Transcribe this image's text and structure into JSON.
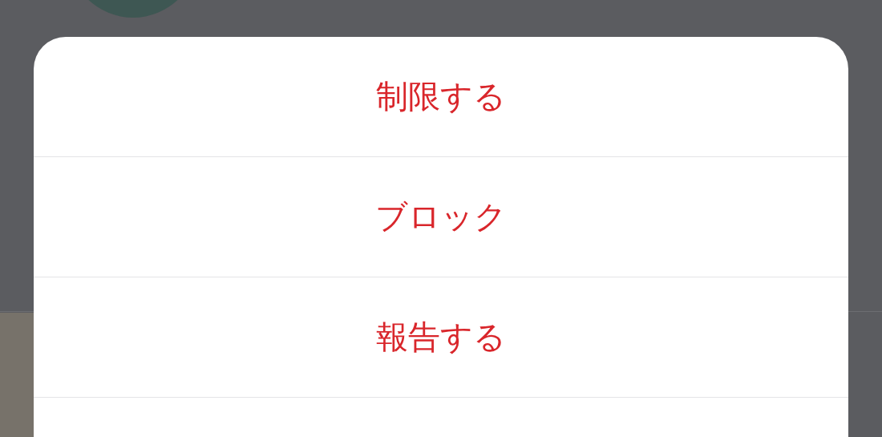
{
  "action_sheet": {
    "items": [
      {
        "label": "制限する"
      },
      {
        "label": "ブロック"
      },
      {
        "label": "報告する"
      }
    ]
  }
}
